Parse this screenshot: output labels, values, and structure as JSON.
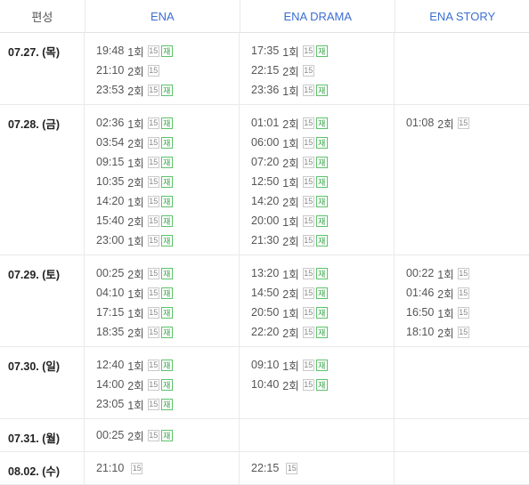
{
  "header": {
    "title": "편성",
    "channels": [
      "ENA",
      "ENA DRAMA",
      "ENA STORY"
    ]
  },
  "rows": [
    {
      "date": "07.27. (목)",
      "cells": [
        [
          {
            "time": "19:48",
            "ep": "1회",
            "rating": "15",
            "re": "재"
          },
          {
            "time": "21:10",
            "ep": "2회",
            "rating": "15",
            "re": ""
          },
          {
            "time": "23:53",
            "ep": "2회",
            "rating": "15",
            "re": "재"
          }
        ],
        [
          {
            "time": "17:35",
            "ep": "1회",
            "rating": "15",
            "re": "재"
          },
          {
            "time": "22:15",
            "ep": "2회",
            "rating": "15",
            "re": ""
          },
          {
            "time": "23:36",
            "ep": "1회",
            "rating": "15",
            "re": "재"
          }
        ],
        []
      ]
    },
    {
      "date": "07.28. (금)",
      "cells": [
        [
          {
            "time": "02:36",
            "ep": "1회",
            "rating": "15",
            "re": "재"
          },
          {
            "time": "03:54",
            "ep": "2회",
            "rating": "15",
            "re": "재"
          },
          {
            "time": "09:15",
            "ep": "1회",
            "rating": "15",
            "re": "재"
          },
          {
            "time": "10:35",
            "ep": "2회",
            "rating": "15",
            "re": "재"
          },
          {
            "time": "14:20",
            "ep": "1회",
            "rating": "15",
            "re": "재"
          },
          {
            "time": "15:40",
            "ep": "2회",
            "rating": "15",
            "re": "재"
          },
          {
            "time": "23:00",
            "ep": "1회",
            "rating": "15",
            "re": "재"
          }
        ],
        [
          {
            "time": "01:01",
            "ep": "2회",
            "rating": "15",
            "re": "재"
          },
          {
            "time": "06:00",
            "ep": "1회",
            "rating": "15",
            "re": "재"
          },
          {
            "time": "07:20",
            "ep": "2회",
            "rating": "15",
            "re": "재"
          },
          {
            "time": "12:50",
            "ep": "1회",
            "rating": "15",
            "re": "재"
          },
          {
            "time": "14:20",
            "ep": "2회",
            "rating": "15",
            "re": "재"
          },
          {
            "time": "20:00",
            "ep": "1회",
            "rating": "15",
            "re": "재"
          },
          {
            "time": "21:30",
            "ep": "2회",
            "rating": "15",
            "re": "재"
          }
        ],
        [
          {
            "time": "01:08",
            "ep": "2회",
            "rating": "15",
            "re": ""
          }
        ]
      ]
    },
    {
      "date": "07.29. (토)",
      "cells": [
        [
          {
            "time": "00:25",
            "ep": "2회",
            "rating": "15",
            "re": "재"
          },
          {
            "time": "04:10",
            "ep": "1회",
            "rating": "15",
            "re": "재"
          },
          {
            "time": "17:15",
            "ep": "1회",
            "rating": "15",
            "re": "재"
          },
          {
            "time": "18:35",
            "ep": "2회",
            "rating": "15",
            "re": "재"
          }
        ],
        [
          {
            "time": "13:20",
            "ep": "1회",
            "rating": "15",
            "re": "재"
          },
          {
            "time": "14:50",
            "ep": "2회",
            "rating": "15",
            "re": "재"
          },
          {
            "time": "20:50",
            "ep": "1회",
            "rating": "15",
            "re": "재"
          },
          {
            "time": "22:20",
            "ep": "2회",
            "rating": "15",
            "re": "재"
          }
        ],
        [
          {
            "time": "00:22",
            "ep": "1회",
            "rating": "15",
            "re": ""
          },
          {
            "time": "01:46",
            "ep": "2회",
            "rating": "15",
            "re": ""
          },
          {
            "time": "16:50",
            "ep": "1회",
            "rating": "15",
            "re": ""
          },
          {
            "time": "18:10",
            "ep": "2회",
            "rating": "15",
            "re": ""
          }
        ]
      ]
    },
    {
      "date": "07.30. (일)",
      "cells": [
        [
          {
            "time": "12:40",
            "ep": "1회",
            "rating": "15",
            "re": "재"
          },
          {
            "time": "14:00",
            "ep": "2회",
            "rating": "15",
            "re": "재"
          },
          {
            "time": "23:05",
            "ep": "1회",
            "rating": "15",
            "re": "재"
          }
        ],
        [
          {
            "time": "09:10",
            "ep": "1회",
            "rating": "15",
            "re": "재"
          },
          {
            "time": "10:40",
            "ep": "2회",
            "rating": "15",
            "re": "재"
          }
        ],
        []
      ]
    },
    {
      "date": "07.31. (월)",
      "cells": [
        [
          {
            "time": "00:25",
            "ep": "2회",
            "rating": "15",
            "re": "재"
          }
        ],
        [],
        []
      ]
    },
    {
      "date": "08.02. (수)",
      "cells": [
        [
          {
            "time": "21:10",
            "ep": "",
            "rating": "15",
            "re": ""
          }
        ],
        [
          {
            "time": "22:15",
            "ep": "",
            "rating": "15",
            "re": ""
          }
        ],
        []
      ]
    }
  ]
}
